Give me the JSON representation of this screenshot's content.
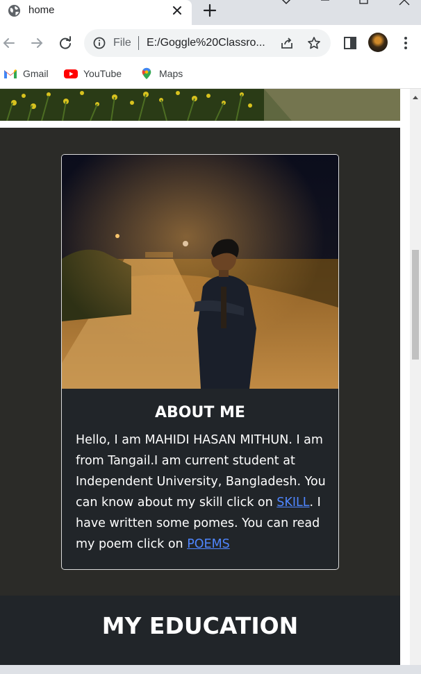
{
  "browser": {
    "tab": {
      "title": "home"
    },
    "omnibox": {
      "scheme": "File",
      "url": "E:/Goggle%20Classro..."
    },
    "bookmarks": [
      {
        "label": "Gmail",
        "icon": "gmail-icon"
      },
      {
        "label": "YouTube",
        "icon": "youtube-icon"
      },
      {
        "label": "Maps",
        "icon": "maps-icon"
      }
    ]
  },
  "page": {
    "about": {
      "title": "ABOUT ME",
      "text_1": "Hello, I am MAHIDI HASAN MITHUN. I am from Tangail.I am current student at Independent University, Bangladesh. You can know about my skill click on ",
      "skill_link": "SKILL",
      "text_2": ". I have written some pomes. You can read my poem click on ",
      "poems_link": "POEMS"
    },
    "education": {
      "title": "MY EDUCATION"
    }
  },
  "colors": {
    "section_bg": "#2b2b28",
    "card_bg": "#212529",
    "link": "#4f86ff",
    "tabstrip": "#dee1e6"
  }
}
